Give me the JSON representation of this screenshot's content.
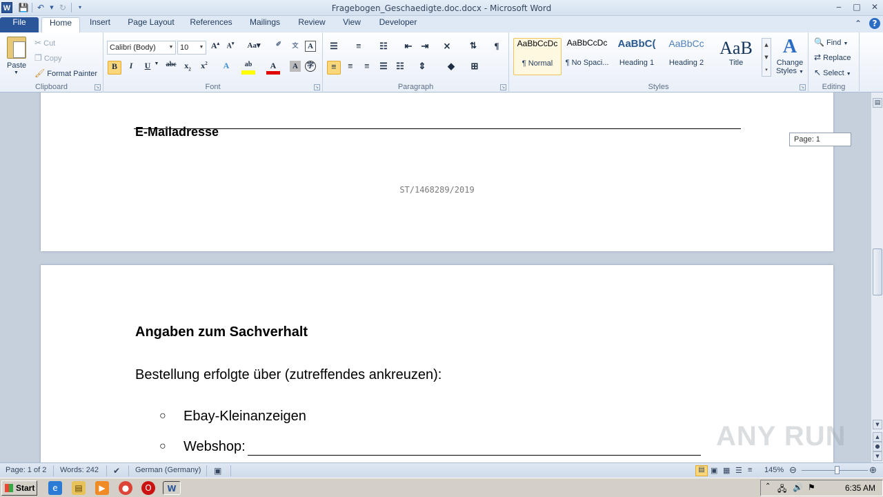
{
  "window": {
    "title": "Fragebogen_Geschaedigte.doc.docx - Microsoft Word",
    "app_icon": "W"
  },
  "tabs": [
    "File",
    "Home",
    "Insert",
    "Page Layout",
    "References",
    "Mailings",
    "Review",
    "View",
    "Developer"
  ],
  "clipboard": {
    "paste": "Paste",
    "cut": "Cut",
    "copy": "Copy",
    "format_painter": "Format Painter",
    "label": "Clipboard"
  },
  "font": {
    "family": "Calibri (Body)",
    "size": "10",
    "label": "Font"
  },
  "paragraph": {
    "label": "Paragraph"
  },
  "styles": {
    "label": "Styles",
    "items": [
      {
        "preview": "AaBbCcDc",
        "name": "¶ Normal"
      },
      {
        "preview": "AaBbCcDc",
        "name": "¶ No Spaci..."
      },
      {
        "preview": "AaBbC(",
        "name": "Heading 1"
      },
      {
        "preview": "AaBbCc",
        "name": "Heading 2"
      },
      {
        "preview": "AaB",
        "name": "Title"
      }
    ],
    "change_styles": [
      "Change",
      "Styles"
    ]
  },
  "editing": {
    "find": "Find",
    "replace": "Replace",
    "select": "Select",
    "label": "Editing"
  },
  "document": {
    "page1": {
      "email_label": "E-Mailadresse",
      "footer_id": "ST/1468289/2019"
    },
    "page2": {
      "heading": "Angaben zum Sachverhalt",
      "question": "Bestellung erfolgte über (zutreffendes ankreuzen):",
      "options": [
        "Ebay-Kleinanzeigen",
        "Webshop:"
      ]
    },
    "page_tooltip": "Page: 1"
  },
  "watermark": "ANY RUN",
  "statusbar": {
    "page": "Page: 1 of 2",
    "words": "Words: 242",
    "language": "German (Germany)",
    "zoom": "145%"
  },
  "taskbar": {
    "start": "Start",
    "clock": "6:35 AM"
  }
}
